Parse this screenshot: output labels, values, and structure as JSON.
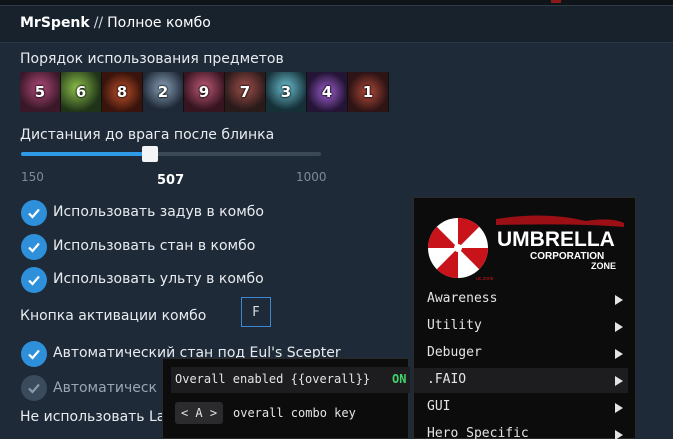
{
  "header": {
    "brand": "MrSpenk",
    "separator": "//",
    "title": "Полное комбо"
  },
  "item_order": {
    "label": "Порядок использования предметов",
    "items": [
      {
        "number": "5",
        "color": "#5a2c44"
      },
      {
        "number": "6",
        "color": "#3c5a2a"
      },
      {
        "number": "8",
        "color": "#6a2a1e"
      },
      {
        "number": "2",
        "color": "#3a4a5e"
      },
      {
        "number": "9",
        "color": "#5e2a36"
      },
      {
        "number": "7",
        "color": "#4a3a3a"
      },
      {
        "number": "3",
        "color": "#2e5a66"
      },
      {
        "number": "4",
        "color": "#4a2a66"
      },
      {
        "number": "1",
        "color": "#5a2a2a"
      }
    ]
  },
  "blink_distance": {
    "label": "Дистанция до врага после блинка",
    "min": "150",
    "max": "1000",
    "value": "507",
    "fraction": 0.42
  },
  "options": [
    {
      "label": "Использовать задув в комбо",
      "checked": true
    },
    {
      "label": "Использовать стан в комбо",
      "checked": true
    },
    {
      "label": "Использовать ульту в комбо",
      "checked": true
    }
  ],
  "activation": {
    "label": "Кнопка активации комбо",
    "key": "F"
  },
  "option_auto_stun": {
    "label": "Автоматический стан под Eul's Scepter",
    "checked": true
  },
  "option_auto_partial": {
    "label": "Автоматическ",
    "checked": false
  },
  "option_no_use_partial": {
    "label": "Не использовать La"
  },
  "overlay_menu": {
    "logo": {
      "title": "UMBRELLA",
      "line2": "CORPORATION",
      "line3": "ZONE",
      "small": "uc.zone"
    },
    "items": [
      "Awareness",
      "Utility",
      "Debuger",
      ".FAIO",
      "GUI",
      "Hero Specific"
    ],
    "active_index": 3
  },
  "overlay_submenu": {
    "row1_text": "Overall enabled {{overall}}",
    "row1_state": "ON",
    "row2_key": "< A >",
    "row2_text": "overall combo key"
  },
  "colors": {
    "accent": "#2e8fdb",
    "on_green": "#3fd36b",
    "logo_red": "#c8131b"
  }
}
